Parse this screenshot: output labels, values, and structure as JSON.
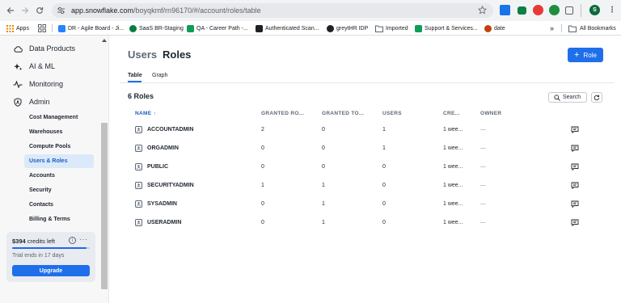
{
  "browser": {
    "url_domain": "app.snowflake.com",
    "url_path": "/boyqkmf/rn96170/#/account/roles/table",
    "bookmarks": [
      {
        "label": "Apps",
        "color": "#ea8600"
      },
      {
        "label": "",
        "color": "#5f6368"
      },
      {
        "label": "DR - Agile Board - Ji...",
        "color": "#2684ff"
      },
      {
        "label": "SaaS BR-Staging",
        "color": "#0a7d3e"
      },
      {
        "label": "QA - Career Path -...",
        "color": "#0f9d58"
      },
      {
        "label": "Authenticated Scan...",
        "color": "#202124"
      },
      {
        "label": "greytHR IDP",
        "color": "#202124"
      },
      {
        "label": "Imported",
        "color": "#5f6368"
      },
      {
        "label": "Support & Services...",
        "color": "#0f9d58"
      },
      {
        "label": "date",
        "color": "#c2410c"
      }
    ],
    "all_bookmarks": "All Bookmarks",
    "profile_initial": "S"
  },
  "sidebar": {
    "top_items": [
      {
        "label": "Data Products",
        "icon": "cloud-icon"
      },
      {
        "label": "AI & ML",
        "icon": "sparkle-icon"
      },
      {
        "label": "Monitoring",
        "icon": "pulse-icon"
      },
      {
        "label": "Admin",
        "icon": "shield-icon"
      }
    ],
    "admin_items": [
      {
        "label": "Cost Management",
        "active": false
      },
      {
        "label": "Warehouses",
        "active": false
      },
      {
        "label": "Compute Pools",
        "active": false
      },
      {
        "label": "Users & Roles",
        "active": true
      },
      {
        "label": "Accounts",
        "active": false
      },
      {
        "label": "Security",
        "active": false
      },
      {
        "label": "Contacts",
        "active": false
      },
      {
        "label": "Billing & Terms",
        "active": false
      }
    ],
    "credits": {
      "amount": "$394",
      "suffix": " credits left",
      "progress": 0.96,
      "trial": "Trial ends in 17 days",
      "upgrade": "Upgrade"
    }
  },
  "main": {
    "breadcrumb_parent": "Users",
    "title": "Roles",
    "add_button": "Role",
    "tabs": [
      {
        "label": "Table"
      },
      {
        "label": "Graph"
      }
    ],
    "count_label": "6 Roles",
    "search_label": "Search",
    "columns": [
      {
        "key": "name",
        "label": "NAME ↑"
      },
      {
        "key": "granted_roles",
        "label": "GRANTED RO..."
      },
      {
        "key": "granted_to",
        "label": "GRANTED TO..."
      },
      {
        "key": "users",
        "label": "USERS"
      },
      {
        "key": "created",
        "label": "CRE..."
      },
      {
        "key": "owner",
        "label": "OWNER"
      }
    ],
    "rows": [
      {
        "name": "ACCOUNTADMIN",
        "granted_roles": "2",
        "granted_to": "0",
        "users": "1",
        "created": "1 wee...",
        "owner": "—"
      },
      {
        "name": "ORGADMIN",
        "granted_roles": "0",
        "granted_to": "0",
        "users": "1",
        "created": "1 wee...",
        "owner": "—"
      },
      {
        "name": "PUBLIC",
        "granted_roles": "0",
        "granted_to": "0",
        "users": "0",
        "created": "1 wee...",
        "owner": "—"
      },
      {
        "name": "SECURITYADMIN",
        "granted_roles": "1",
        "granted_to": "1",
        "users": "0",
        "created": "1 wee...",
        "owner": "—"
      },
      {
        "name": "SYSADMIN",
        "granted_roles": "0",
        "granted_to": "1",
        "users": "0",
        "created": "1 wee...",
        "owner": "—"
      },
      {
        "name": "USERADMIN",
        "granted_roles": "0",
        "granted_to": "1",
        "users": "0",
        "created": "1 wee...",
        "owner": "—"
      }
    ]
  }
}
